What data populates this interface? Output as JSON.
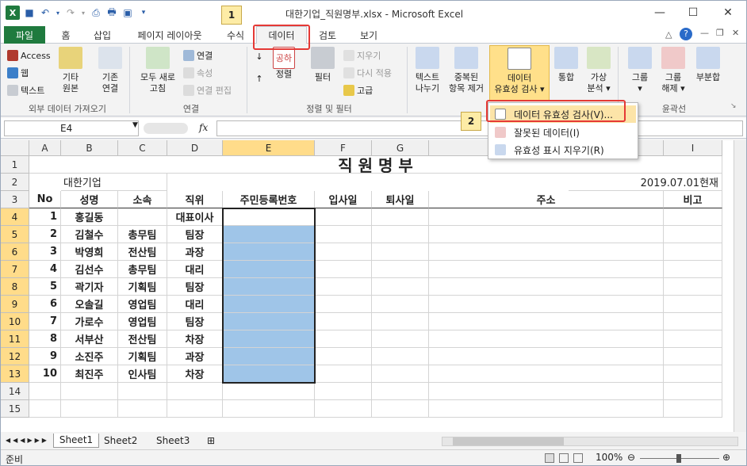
{
  "window": {
    "title": "대한기업_직원명부.xlsx - Microsoft Excel",
    "app_icon": "X"
  },
  "tabs": [
    "파일",
    "홈",
    "삽입",
    "페이지 레이아웃",
    "수식",
    "데이터",
    "검토",
    "보기"
  ],
  "callouts": [
    "1",
    "2"
  ],
  "ribbon": {
    "external": {
      "access": "Access",
      "web": "웹",
      "text": "텍스트",
      "other": "기타",
      "other2": "원본",
      "existing": "기존",
      "existing2": "연결",
      "group": "외부 데이터 가져오기"
    },
    "connections": {
      "refresh": "모두 새로",
      "refresh2": "고침",
      "conn": "연결",
      "props": "속성",
      "edit": "연결 편집",
      "group": "연결"
    },
    "sort": {
      "sort": "정렬",
      "filter": "필터",
      "clear": "지우기",
      "reapply": "다시 적용",
      "advanced": "고급",
      "group": "정렬 및 필터",
      "az": "공하"
    },
    "tools": {
      "t2c": "텍스트",
      "t2c2": "나누기",
      "dup": "중복된",
      "dup2": "항목 제거",
      "dv": "데이터",
      "dv2": "유효성 검사",
      "cons": "통합",
      "whatif": "가상",
      "whatif2": "분석"
    },
    "outline": {
      "group_btn": "그룹",
      "ungroup": "그룹",
      "ungroup2": "해제",
      "subtotal": "부분합",
      "group": "윤곽선"
    }
  },
  "formula": {
    "namebox": "E4",
    "fx": "fx",
    "value": ""
  },
  "columns": [
    "A",
    "B",
    "C",
    "D",
    "E",
    "F",
    "G",
    "H",
    "I"
  ],
  "rows": [
    "1",
    "2",
    "3",
    "4",
    "5",
    "6",
    "7",
    "8",
    "9",
    "10",
    "11",
    "12",
    "13",
    "14",
    "15"
  ],
  "sheet": {
    "title": "직  원  명  부",
    "company": "대한기업",
    "date": "2019.07.01현재",
    "headers": [
      "No",
      "성명",
      "소속",
      "직위",
      "주민등록번호",
      "입사일",
      "퇴사일",
      "주소",
      "비고"
    ],
    "data": [
      [
        "1",
        "홍길동",
        "",
        "대표이사"
      ],
      [
        "2",
        "김철수",
        "총무팀",
        "팀장"
      ],
      [
        "3",
        "박영희",
        "전산팀",
        "과장"
      ],
      [
        "4",
        "김선수",
        "총무팀",
        "대리"
      ],
      [
        "5",
        "곽기자",
        "기획팀",
        "팀장"
      ],
      [
        "6",
        "오솔길",
        "영업팀",
        "대리"
      ],
      [
        "7",
        "가로수",
        "영업팀",
        "팀장"
      ],
      [
        "8",
        "서부산",
        "전산팀",
        "차장"
      ],
      [
        "9",
        "소진주",
        "기획팀",
        "과장"
      ],
      [
        "10",
        "최진주",
        "인사팀",
        "차장"
      ]
    ]
  },
  "dropdown": [
    "데이터 유효성 검사(V)...",
    "잘못된 데이터(I)",
    "유효성 표시 지우기(R)"
  ],
  "sheettabs": [
    "Sheet1",
    "Sheet2",
    "Sheet3"
  ],
  "status": {
    "ready": "준비",
    "zoom": "100%"
  },
  "colors": {
    "excel_green": "#1f7a3e",
    "selection": "#9fc5e8",
    "highlight": "#ffe08a",
    "callout_red": "#e53935"
  }
}
